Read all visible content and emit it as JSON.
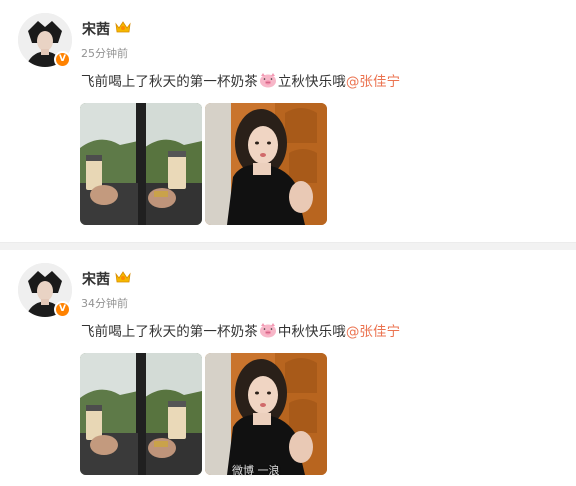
{
  "posts": [
    {
      "user_name": "宋茜",
      "timestamp": "25分钟前",
      "verified_badge": "V",
      "text_main": "飞前喝上了秋天的第一杯奶茶",
      "emoji": "pig-face-emoji",
      "text_after": "立秋快乐哦",
      "mention": "@张佳宁",
      "images": [
        "train-window-milk-tea-photo",
        "selfie-orange-wall-photo"
      ]
    },
    {
      "user_name": "宋茜",
      "timestamp": "34分钟前",
      "verified_badge": "V",
      "text_main": "飞前喝上了秋天的第一杯奶茶",
      "emoji": "pig-face-emoji",
      "text_after": "中秋快乐哦",
      "mention": "@张佳宁",
      "images": [
        "train-window-milk-tea-photo",
        "selfie-orange-wall-photo"
      ],
      "watermark": "微博 一浪"
    }
  ],
  "colors": {
    "mention": "#eb7350",
    "verified": "#ff8200",
    "timestamp": "#939393"
  }
}
